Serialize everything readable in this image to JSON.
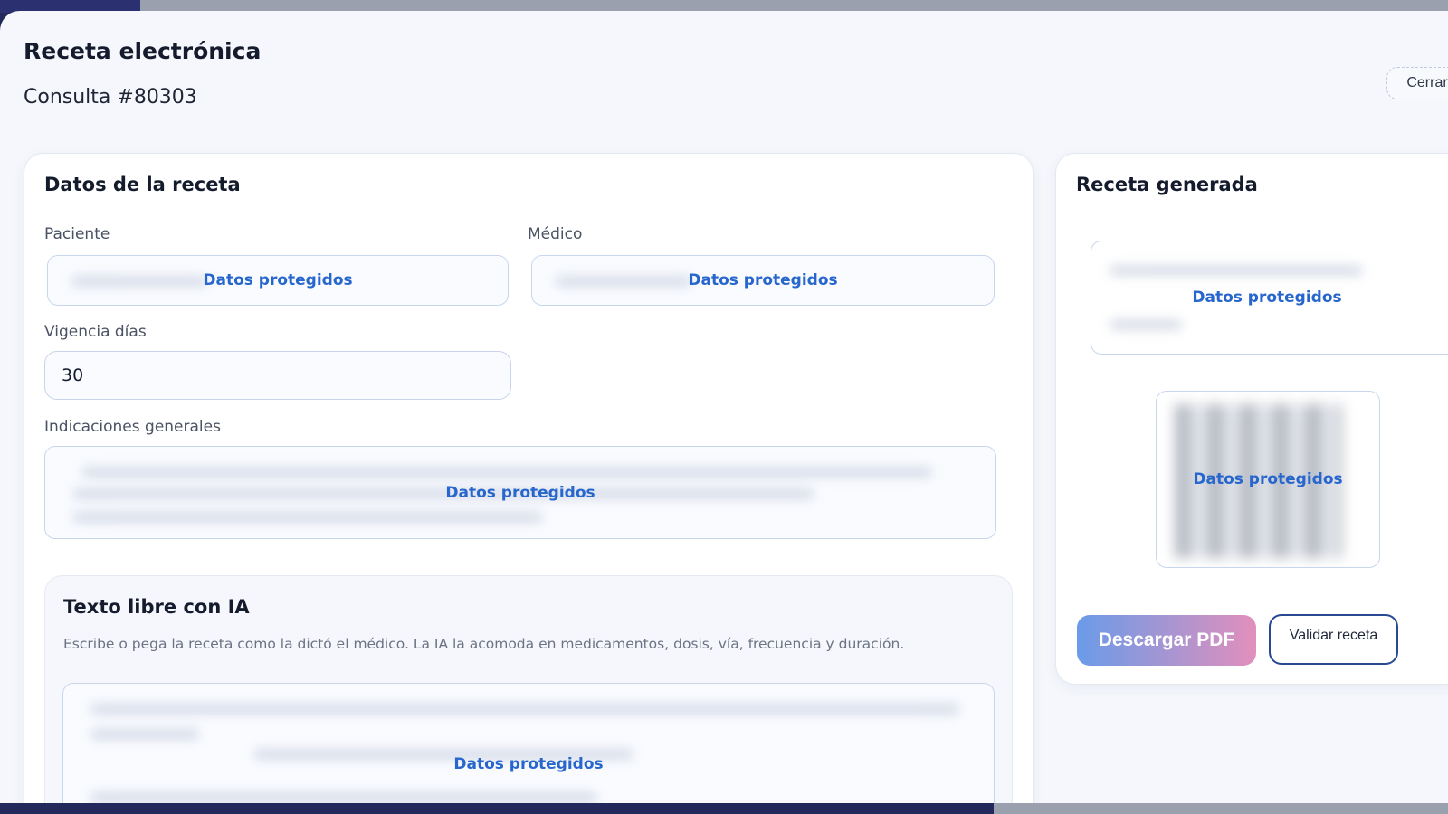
{
  "modal": {
    "title": "Receta electrónica",
    "subtitle": "Consulta #80303",
    "close_label": "Cerrar"
  },
  "form": {
    "title": "Datos de la receta",
    "patient_label": "Paciente",
    "doctor_label": "Médico",
    "validity_label": "Vigencia días",
    "validity_value": "30",
    "instructions_label": "Indicaciones generales",
    "protected_text": "Datos protegidos"
  },
  "ai_section": {
    "title": "Texto libre con IA",
    "description": "Escribe o pega la receta como la dictó el médico. La IA la acomoda en medicamentos, dosis, vía, frecuencia y duración.",
    "protected_text": "Datos protegidos"
  },
  "generated": {
    "title": "Receta generada",
    "protected_text": "Datos protegidos",
    "download_label": "Descargar PDF",
    "validate_label": "Validar receta"
  },
  "colors": {
    "accent": "#2766cc",
    "gradient_start": "#6a9be8",
    "gradient_end": "#e28fbc",
    "outline": "#274a93"
  }
}
